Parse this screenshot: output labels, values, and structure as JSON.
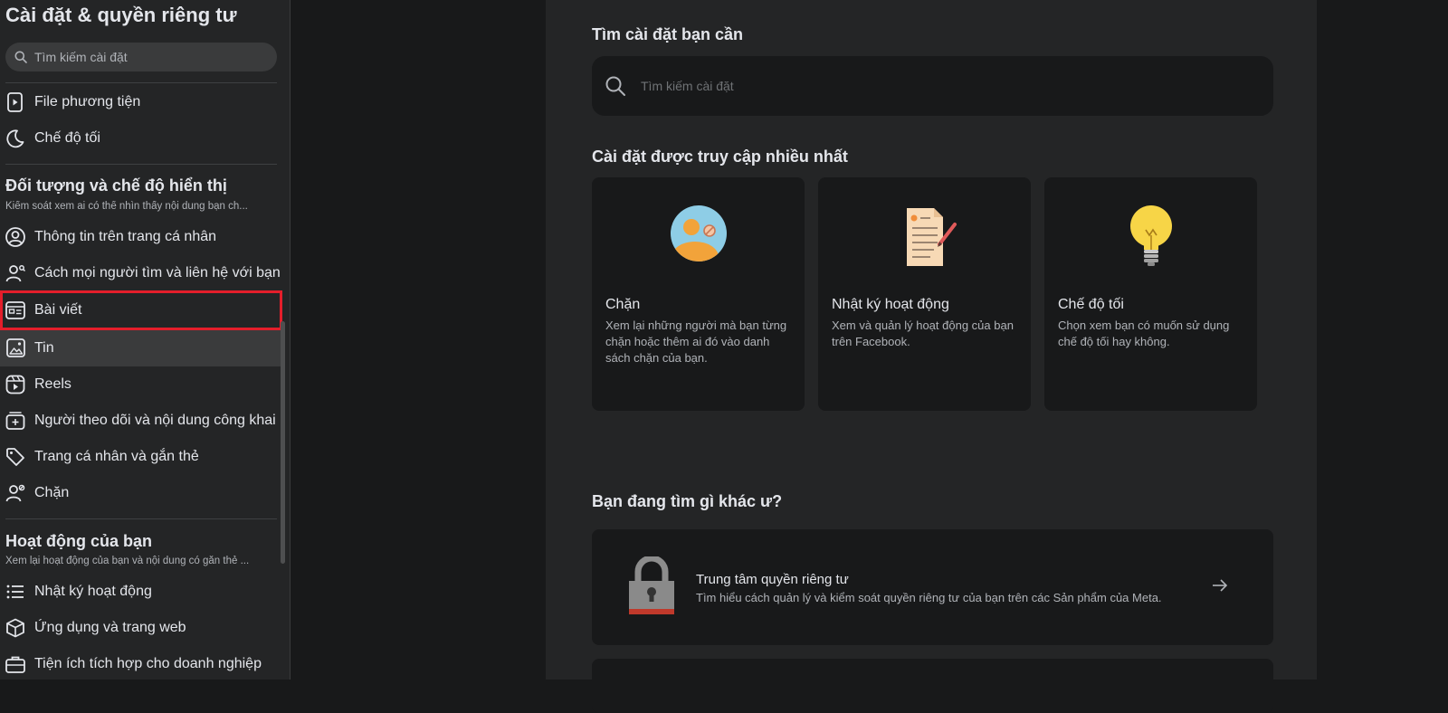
{
  "sidebar": {
    "title": "Cài đặt & quyền riêng tư",
    "search_placeholder": "Tìm kiếm cài đặt",
    "top_items": [
      {
        "label": "File phương tiện",
        "icon": "media-file-icon"
      },
      {
        "label": "Chế độ tối",
        "icon": "moon-icon"
      }
    ],
    "section_audience": {
      "heading": "Đối tượng và chế độ hiển thị",
      "subtitle": "Kiểm soát xem ai có thể nhìn thấy nội dung bạn ch...",
      "items": [
        {
          "label": "Thông tin trên trang cá nhân",
          "icon": "profile-circle-icon"
        },
        {
          "label": "Cách mọi người tìm và liên hệ với bạn",
          "icon": "person-search-icon"
        },
        {
          "label": "Bài viết",
          "icon": "post-icon"
        },
        {
          "label": "Tin",
          "icon": "stories-icon"
        },
        {
          "label": "Reels",
          "icon": "reels-icon"
        },
        {
          "label": "Người theo dõi và nội dung công khai",
          "icon": "followers-icon"
        },
        {
          "label": "Trang cá nhân và gắn thẻ",
          "icon": "tag-icon"
        },
        {
          "label": "Chặn",
          "icon": "block-person-icon"
        }
      ]
    },
    "section_activity": {
      "heading": "Hoạt động của bạn",
      "subtitle": "Xem lại hoạt động của bạn và nội dung có gắn thẻ ...",
      "items": [
        {
          "label": "Nhật ký hoạt động",
          "icon": "list-icon"
        },
        {
          "label": "Ứng dụng và trang web",
          "icon": "cube-icon"
        },
        {
          "label": "Tiện ích tích hợp cho doanh nghiệp",
          "icon": "briefcase-icon"
        }
      ]
    }
  },
  "main": {
    "search_heading": "Tìm cài đặt bạn cần",
    "search_placeholder": "Tìm kiếm cài đặt",
    "most_accessed_heading": "Cài đặt được truy cập nhiều nhất",
    "cards": [
      {
        "title": "Chặn",
        "desc": "Xem lại những người mà bạn từng chặn hoặc thêm ai đó vào danh sách chặn của bạn.",
        "icon": "blocked-user-illustration"
      },
      {
        "title": "Nhật ký hoạt động",
        "desc": "Xem và quản lý hoạt động của bạn trên Facebook.",
        "icon": "activity-log-illustration"
      },
      {
        "title": "Chế độ tối",
        "desc": "Chọn xem bạn có muốn sử dụng chế độ tối hay không.",
        "icon": "lightbulb-illustration"
      }
    ],
    "other_heading": "Bạn đang tìm gì khác ư?",
    "privacy_center": {
      "title": "Trung tâm quyền riêng tư",
      "desc": "Tìm hiểu cách quản lý và kiểm soát quyền riêng tư của bạn trên các Sản phẩm của Meta.",
      "icon": "padlock-illustration"
    }
  },
  "colors": {
    "background": "#18191a",
    "panel": "#242526",
    "highlight_box": "#e41e2b",
    "active_item": "#3a3b3c"
  }
}
